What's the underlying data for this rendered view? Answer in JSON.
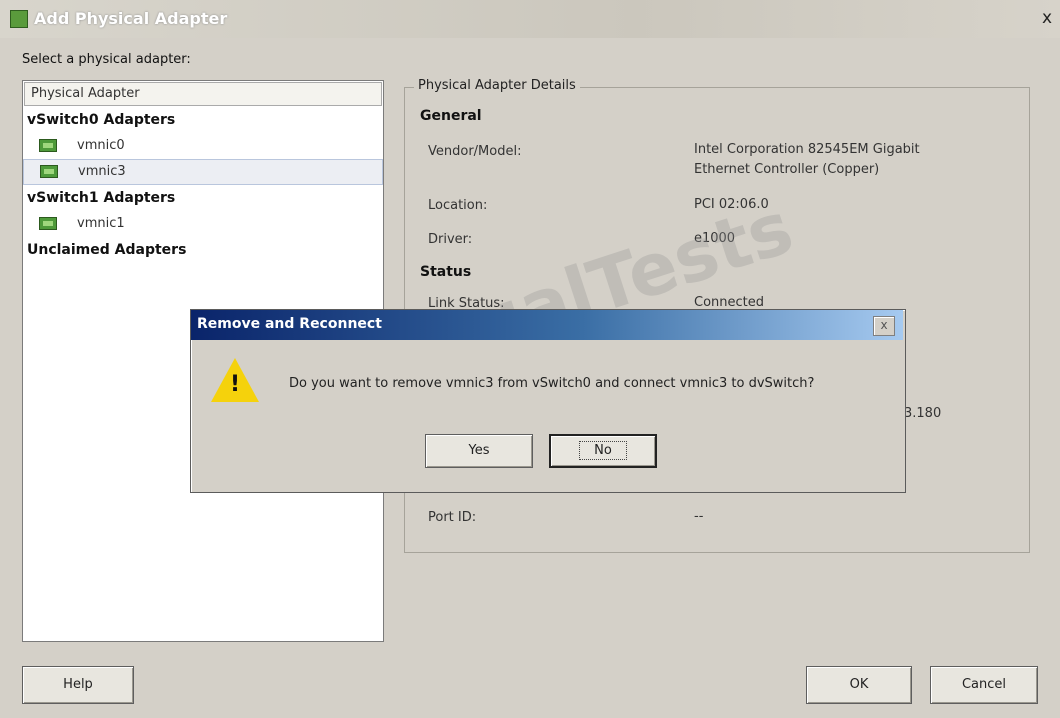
{
  "window": {
    "title": "Add Physical Adapter",
    "close_glyph": "x",
    "icon": "network-adapter-icon"
  },
  "select_label": "Select a physical adapter:",
  "adapter_list": {
    "header": "Physical Adapter",
    "groups": [
      {
        "label": "vSwitch0 Adapters",
        "items": [
          "vmnic0",
          "vmnic3"
        ]
      },
      {
        "label": "vSwitch1 Adapters",
        "items": [
          "vmnic1"
        ]
      },
      {
        "label": "Unclaimed Adapters",
        "items": []
      }
    ],
    "selected": "vmnic3"
  },
  "details": {
    "box_title": "Physical Adapter Details",
    "general_heading": "General",
    "vendor_label": "Vendor/Model:",
    "vendor_value_line1": "Intel Corporation 82545EM Gigabit",
    "vendor_value_line2": "Ethernet Controller (Copper)",
    "location_label": "Location:",
    "location_value": "PCI 02:06.0",
    "driver_label": "Driver:",
    "driver_value": "e1000",
    "status_heading": "Status",
    "link_status_label": "Link Status:",
    "link_status_value": "Connected",
    "partial_ip_value": "3.180",
    "port_id_label": "Port ID:",
    "port_id_value": "--"
  },
  "buttons": {
    "help": "Help",
    "ok": "OK",
    "cancel": "Cancel"
  },
  "modal": {
    "title": "Remove and Reconnect",
    "close_glyph": "x",
    "icon": "warning-icon",
    "warning_glyph": "!",
    "message": "Do you want to remove vmnic3 from vSwitch0 and connect vmnic3 to dvSwitch?",
    "yes": "Yes",
    "no": "No"
  },
  "watermark": "ActualTests"
}
